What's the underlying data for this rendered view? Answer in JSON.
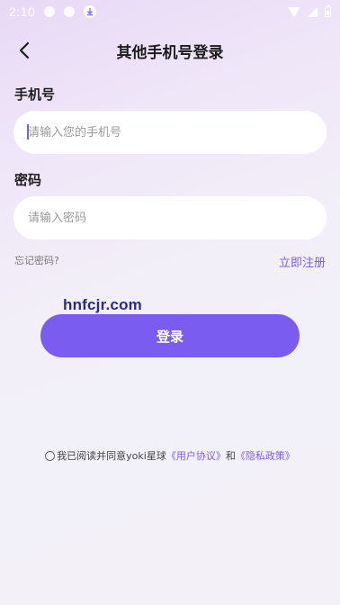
{
  "status_bar": {
    "time": "2:10",
    "icons": [
      "notification-icon",
      "notification-icon",
      "download-icon",
      "wifi-icon",
      "signal-icon",
      "battery-icon"
    ]
  },
  "header": {
    "title": "其他手机号登录",
    "back_icon": "chevron-left-icon"
  },
  "form": {
    "phone_label": "手机号",
    "phone_placeholder": "请输入您的手机号",
    "password_label": "密码",
    "password_placeholder": "请输入密码",
    "forgot_password": "忘记密码?",
    "register": "立即注册",
    "login_button": "登录"
  },
  "watermark": "hnfcjr.com",
  "agreement": {
    "prefix": "我已阅读并同意yoki星球",
    "user_agreement": "《用户协议》",
    "and": "和",
    "privacy_policy": "《隐私政策》"
  },
  "colors": {
    "accent": "#7b5cf0",
    "background_top": "#e8d9f6",
    "background_bottom": "#f3f1f7"
  }
}
